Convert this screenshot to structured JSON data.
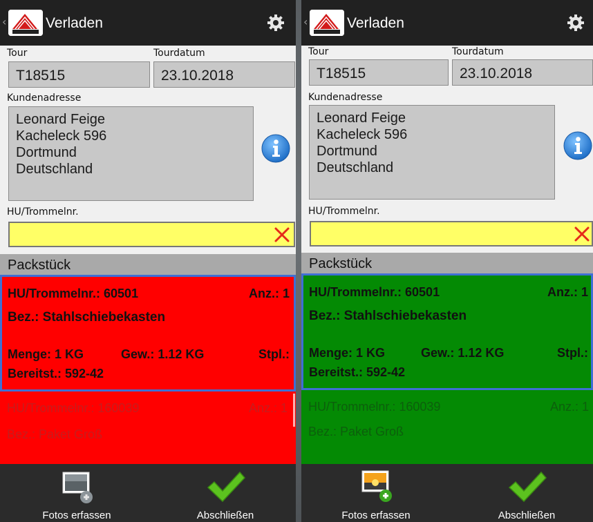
{
  "screens": [
    {
      "id": "left",
      "app_title": "Verladen",
      "tour_label": "Tour",
      "tour_value": "T18515",
      "tourdatum_label": "Tourdatum",
      "tourdatum_value": "23.10.2018",
      "kundenadresse_label": "Kundenadresse",
      "address_lines": [
        "Leonard Feige",
        "Kacheleck 596",
        "Dortmund",
        "Deutschland"
      ],
      "hu_label": "HU/Trommelnr.",
      "hu_input_value": "",
      "section_title": "Packstück",
      "item_color": "#ff0000",
      "items": [
        {
          "hu": "HU/Trommelnr.: 60501",
          "anz": "Anz.: 1",
          "bez": "Bez.: Stahlschiebekasten",
          "menge": "Menge: 1 KG",
          "gew": "Gew.: 1.12 KG",
          "stpl": "Stpl.:",
          "bereitst": "Bereitst.: 592-42"
        },
        {
          "hu": "HU/Trommelnr.: 160039",
          "anz": "Anz.: 1",
          "bez": "Bez.: Paket Groß"
        }
      ],
      "bottom": {
        "photos_label": "Fotos erfassen",
        "finish_label": "Abschließen"
      }
    },
    {
      "id": "right",
      "app_title": "Verladen",
      "tour_label": "Tour",
      "tour_value": "T18515",
      "tourdatum_label": "Tourdatum",
      "tourdatum_value": "23.10.2018",
      "kundenadresse_label": "Kundenadresse",
      "address_lines": [
        "Leonard Feige",
        "Kacheleck 596",
        "Dortmund",
        "Deutschland"
      ],
      "hu_label": "HU/Trommelnr.",
      "hu_input_value": "",
      "section_title": "Packstück",
      "item_color": "#048a04",
      "items": [
        {
          "hu": "HU/Trommelnr.: 60501",
          "anz": "Anz.: 1",
          "bez": "Bez.: Stahlschiebekasten",
          "menge": "Menge: 1 KG",
          "gew": "Gew.: 1.12 KG",
          "stpl": "Stpl.:",
          "bereitst": "Bereitst.: 592-42"
        },
        {
          "hu": "HU/Trommelnr.: 160039",
          "anz": "Anz.: 1",
          "bez": "Bez.: Paket Groß"
        }
      ],
      "bottom": {
        "photos_label": "Fotos erfassen",
        "finish_label": "Abschließen"
      }
    }
  ],
  "colors": {
    "actionbar": "#212121",
    "input_yellow": "#ffff66",
    "info_blue": "#2a7fd6",
    "check_green": "#5cc21f"
  },
  "icons": [
    "back-chevron-icon",
    "company-logo-icon",
    "gear-icon",
    "info-icon",
    "clear-x-icon",
    "photo-add-icon",
    "checkmark-icon"
  ]
}
